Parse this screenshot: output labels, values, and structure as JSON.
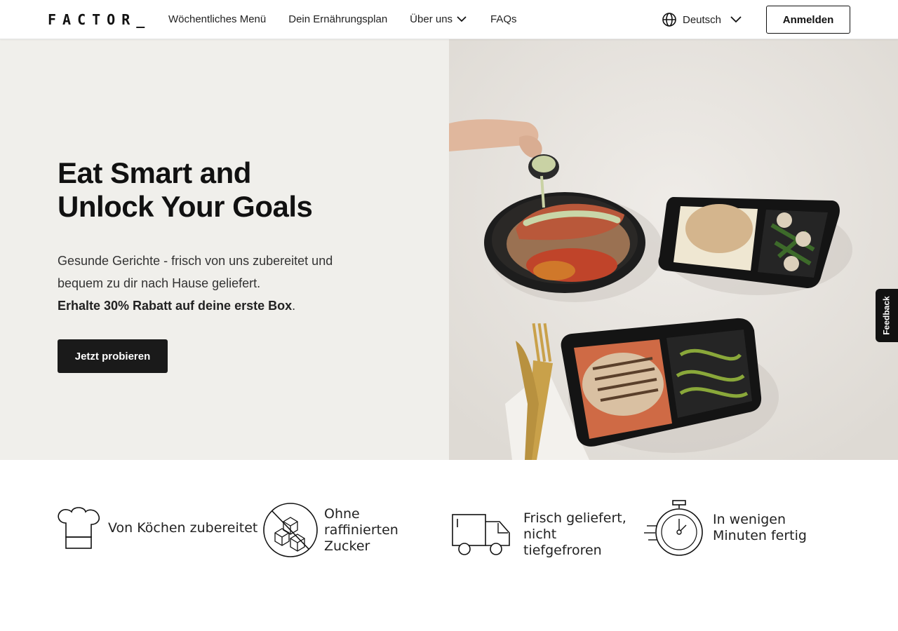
{
  "header": {
    "logo": "FACTOR_",
    "nav": [
      {
        "label": "Wöchentliches Menü"
      },
      {
        "label": "Dein Ernährungsplan"
      },
      {
        "label": "Über uns"
      },
      {
        "label": "FAQs"
      }
    ],
    "language": "Deutsch",
    "login_label": "Anmelden"
  },
  "hero": {
    "title_line1": "Eat Smart and",
    "title_line2": "Unlock Your Goals",
    "subtitle": "Gesunde Gerichte - frisch von uns zubereitet und bequem zu dir nach Hause geliefert.",
    "offer": "Erhalte 30% Rabatt auf deine erste Box",
    "offer_suffix": ".",
    "cta_label": "Jetzt probieren"
  },
  "feedback_label": "Feedback",
  "benefits": [
    {
      "icon": "chef-hat-icon",
      "label": "Von Köchen zubereitet"
    },
    {
      "icon": "no-sugar-icon",
      "label": "Ohne raffinierten Zucker"
    },
    {
      "icon": "delivery-truck-icon",
      "label": "Frisch geliefert, nicht tiefgefroren"
    },
    {
      "icon": "stopwatch-icon",
      "label": "In wenigen Minuten fertig"
    }
  ],
  "colors": {
    "hero_bg": "#f0efeb",
    "button_dark": "#1a1a1a",
    "text": "#111111"
  }
}
